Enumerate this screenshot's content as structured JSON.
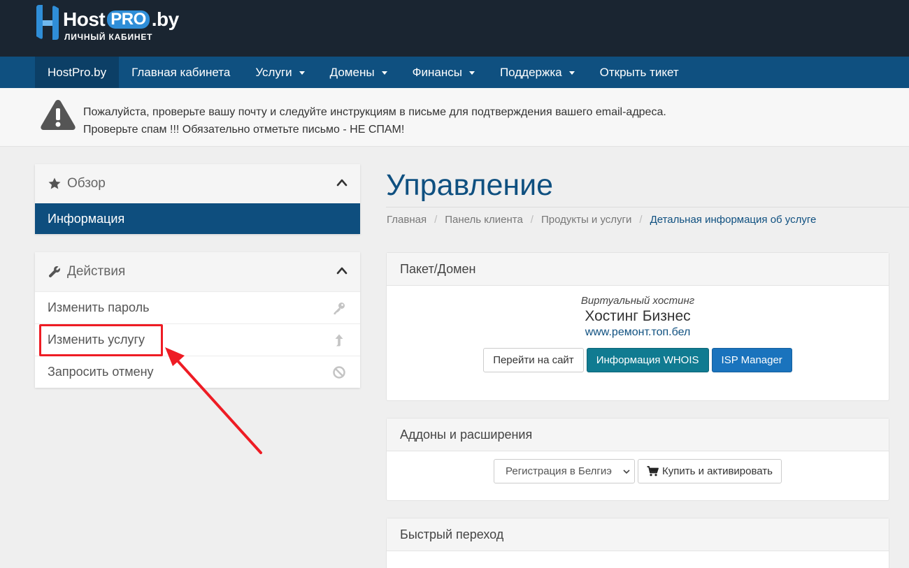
{
  "brand": {
    "host": "Host",
    "pro": "PRO",
    "by": ".by",
    "subtitle": "ЛИЧНЫЙ КАБИНЕТ"
  },
  "nav": {
    "items": [
      {
        "label": "HostPro.by"
      },
      {
        "label": "Главная кабинета"
      },
      {
        "label": "Услуги"
      },
      {
        "label": "Домены"
      },
      {
        "label": "Финансы"
      },
      {
        "label": "Поддержка"
      },
      {
        "label": "Открыть тикет"
      }
    ]
  },
  "alert": {
    "line1": "Пожалуйста, проверьте вашу почту и следуйте инструкциям в письме для подтверждения вашего email-адреса.",
    "line2": "Проверьте спам !!! Обязательно отметьте письмо - НЕ СПАМ!"
  },
  "sidebar": {
    "overview": {
      "title": "Обзор",
      "item": "Информация"
    },
    "actions": {
      "title": "Действия",
      "items": [
        {
          "label": "Изменить пароль",
          "icon": "key-icon"
        },
        {
          "label": "Изменить услугу",
          "icon": "arrow-up-icon"
        },
        {
          "label": "Запросить отмену",
          "icon": "ban-icon"
        }
      ]
    }
  },
  "main": {
    "title": "Управление",
    "breadcrumb": [
      "Главная",
      "Панель клиента",
      "Продукты и услуги",
      "Детальная информация об услуге"
    ],
    "package": {
      "header": "Пакет/Домен",
      "type": "Виртуальный хостинг",
      "name": "Хостинг Бизнес",
      "domain": "www.ремонт.топ.бел",
      "buttons": {
        "visit": "Перейти на сайт",
        "whois": "Информация WHOIS",
        "isp": "ISP Manager"
      }
    },
    "addons": {
      "header": "Аддоны и расширения",
      "select_value": "Регистрация в Белгиэ",
      "buy_label": "Купить и активировать"
    },
    "quick": {
      "header": "Быстрый переход"
    }
  },
  "colors": {
    "topbar": "#1a2531",
    "nav": "#0f5080",
    "nav_active": "#0c3f66",
    "accent": "#0e4e7e",
    "teal_button": "#107b91",
    "blue_button": "#1a73bd",
    "annotation": "#ee1c24"
  }
}
